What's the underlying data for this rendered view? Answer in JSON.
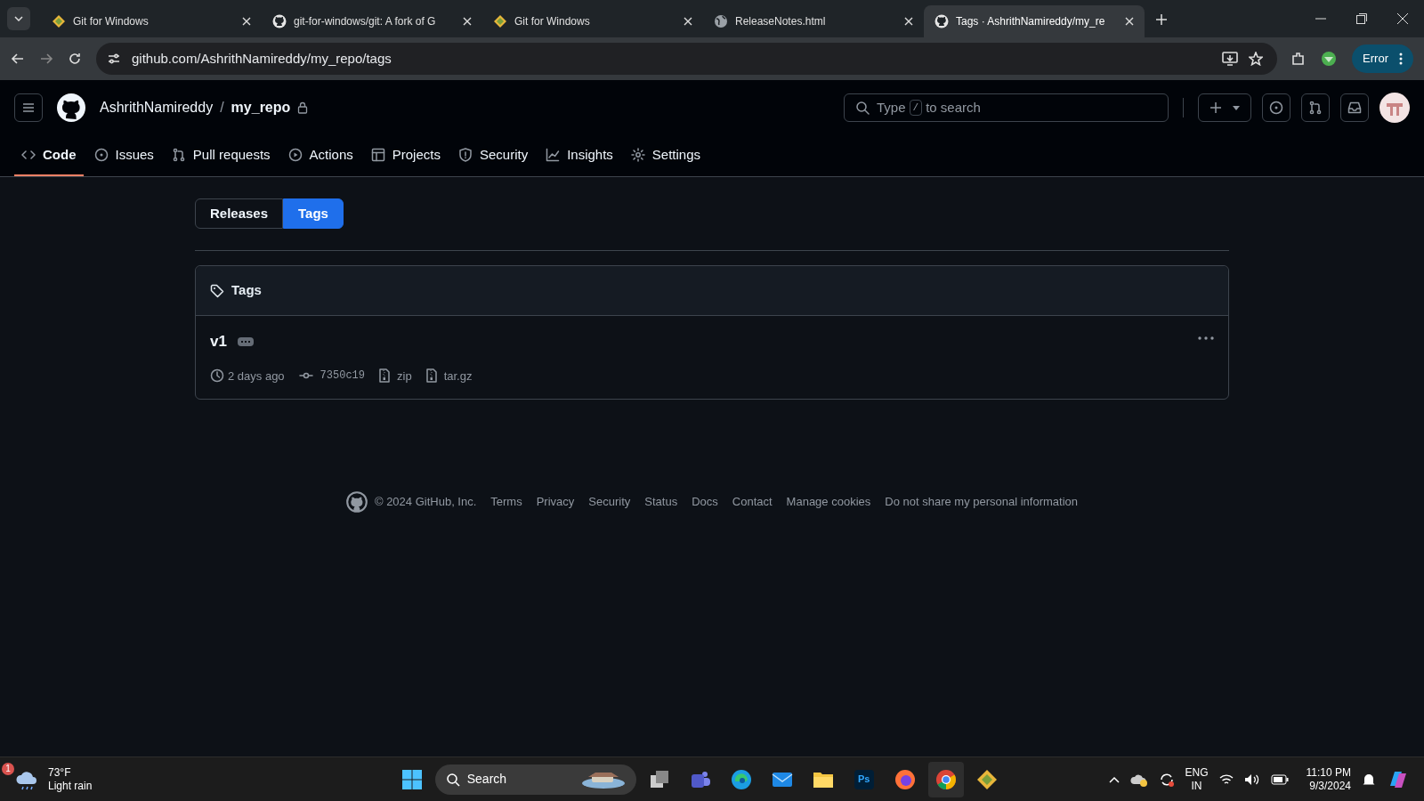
{
  "browser": {
    "tabs": [
      {
        "title": "Git for Windows",
        "kind": "git",
        "selected": false
      },
      {
        "title": "git-for-windows/git: A fork of G",
        "kind": "github",
        "selected": false
      },
      {
        "title": "Git for Windows",
        "kind": "git",
        "selected": false
      },
      {
        "title": "ReleaseNotes.html",
        "kind": "globe",
        "selected": false
      },
      {
        "title": "Tags · AshrithNamireddy/my_re",
        "kind": "github",
        "selected": true
      }
    ],
    "address": "github.com/AshrithNamireddy/my_repo/tags",
    "profile_button": "Error"
  },
  "header": {
    "owner": "AshrithNamireddy",
    "separator": "/",
    "repo": "my_repo",
    "search": {
      "before": "Type",
      "key": "/",
      "after": "to search"
    }
  },
  "repo_nav": [
    {
      "label": "Code",
      "kind": "code",
      "selected": true
    },
    {
      "label": "Issues",
      "kind": "issue",
      "selected": false
    },
    {
      "label": "Pull requests",
      "kind": "pr",
      "selected": false
    },
    {
      "label": "Actions",
      "kind": "play",
      "selected": false
    },
    {
      "label": "Projects",
      "kind": "table",
      "selected": false
    },
    {
      "label": "Security",
      "kind": "shield",
      "selected": false
    },
    {
      "label": "Insights",
      "kind": "graph",
      "selected": false
    },
    {
      "label": "Settings",
      "kind": "gear",
      "selected": false
    }
  ],
  "subnav": [
    {
      "label": "Releases",
      "selected": false
    },
    {
      "label": "Tags",
      "selected": true
    }
  ],
  "tags_box": {
    "title": "Tags",
    "tags": [
      {
        "name": "v1",
        "age": "2 days ago",
        "commit": "7350c19",
        "zip": "zip",
        "targz": "tar.gz"
      }
    ]
  },
  "footer": {
    "copyright": "© 2024 GitHub, Inc.",
    "links": [
      "Terms",
      "Privacy",
      "Security",
      "Status",
      "Docs",
      "Contact",
      "Manage cookies",
      "Do not share my personal information"
    ]
  },
  "taskbar": {
    "weather": {
      "badge": "1",
      "temp": "73°F",
      "condition": "Light rain"
    },
    "search": "Search",
    "photoshop": "Ps",
    "language": "ENG",
    "region": "IN",
    "time": "11:10 PM",
    "date": "9/3/2024"
  }
}
